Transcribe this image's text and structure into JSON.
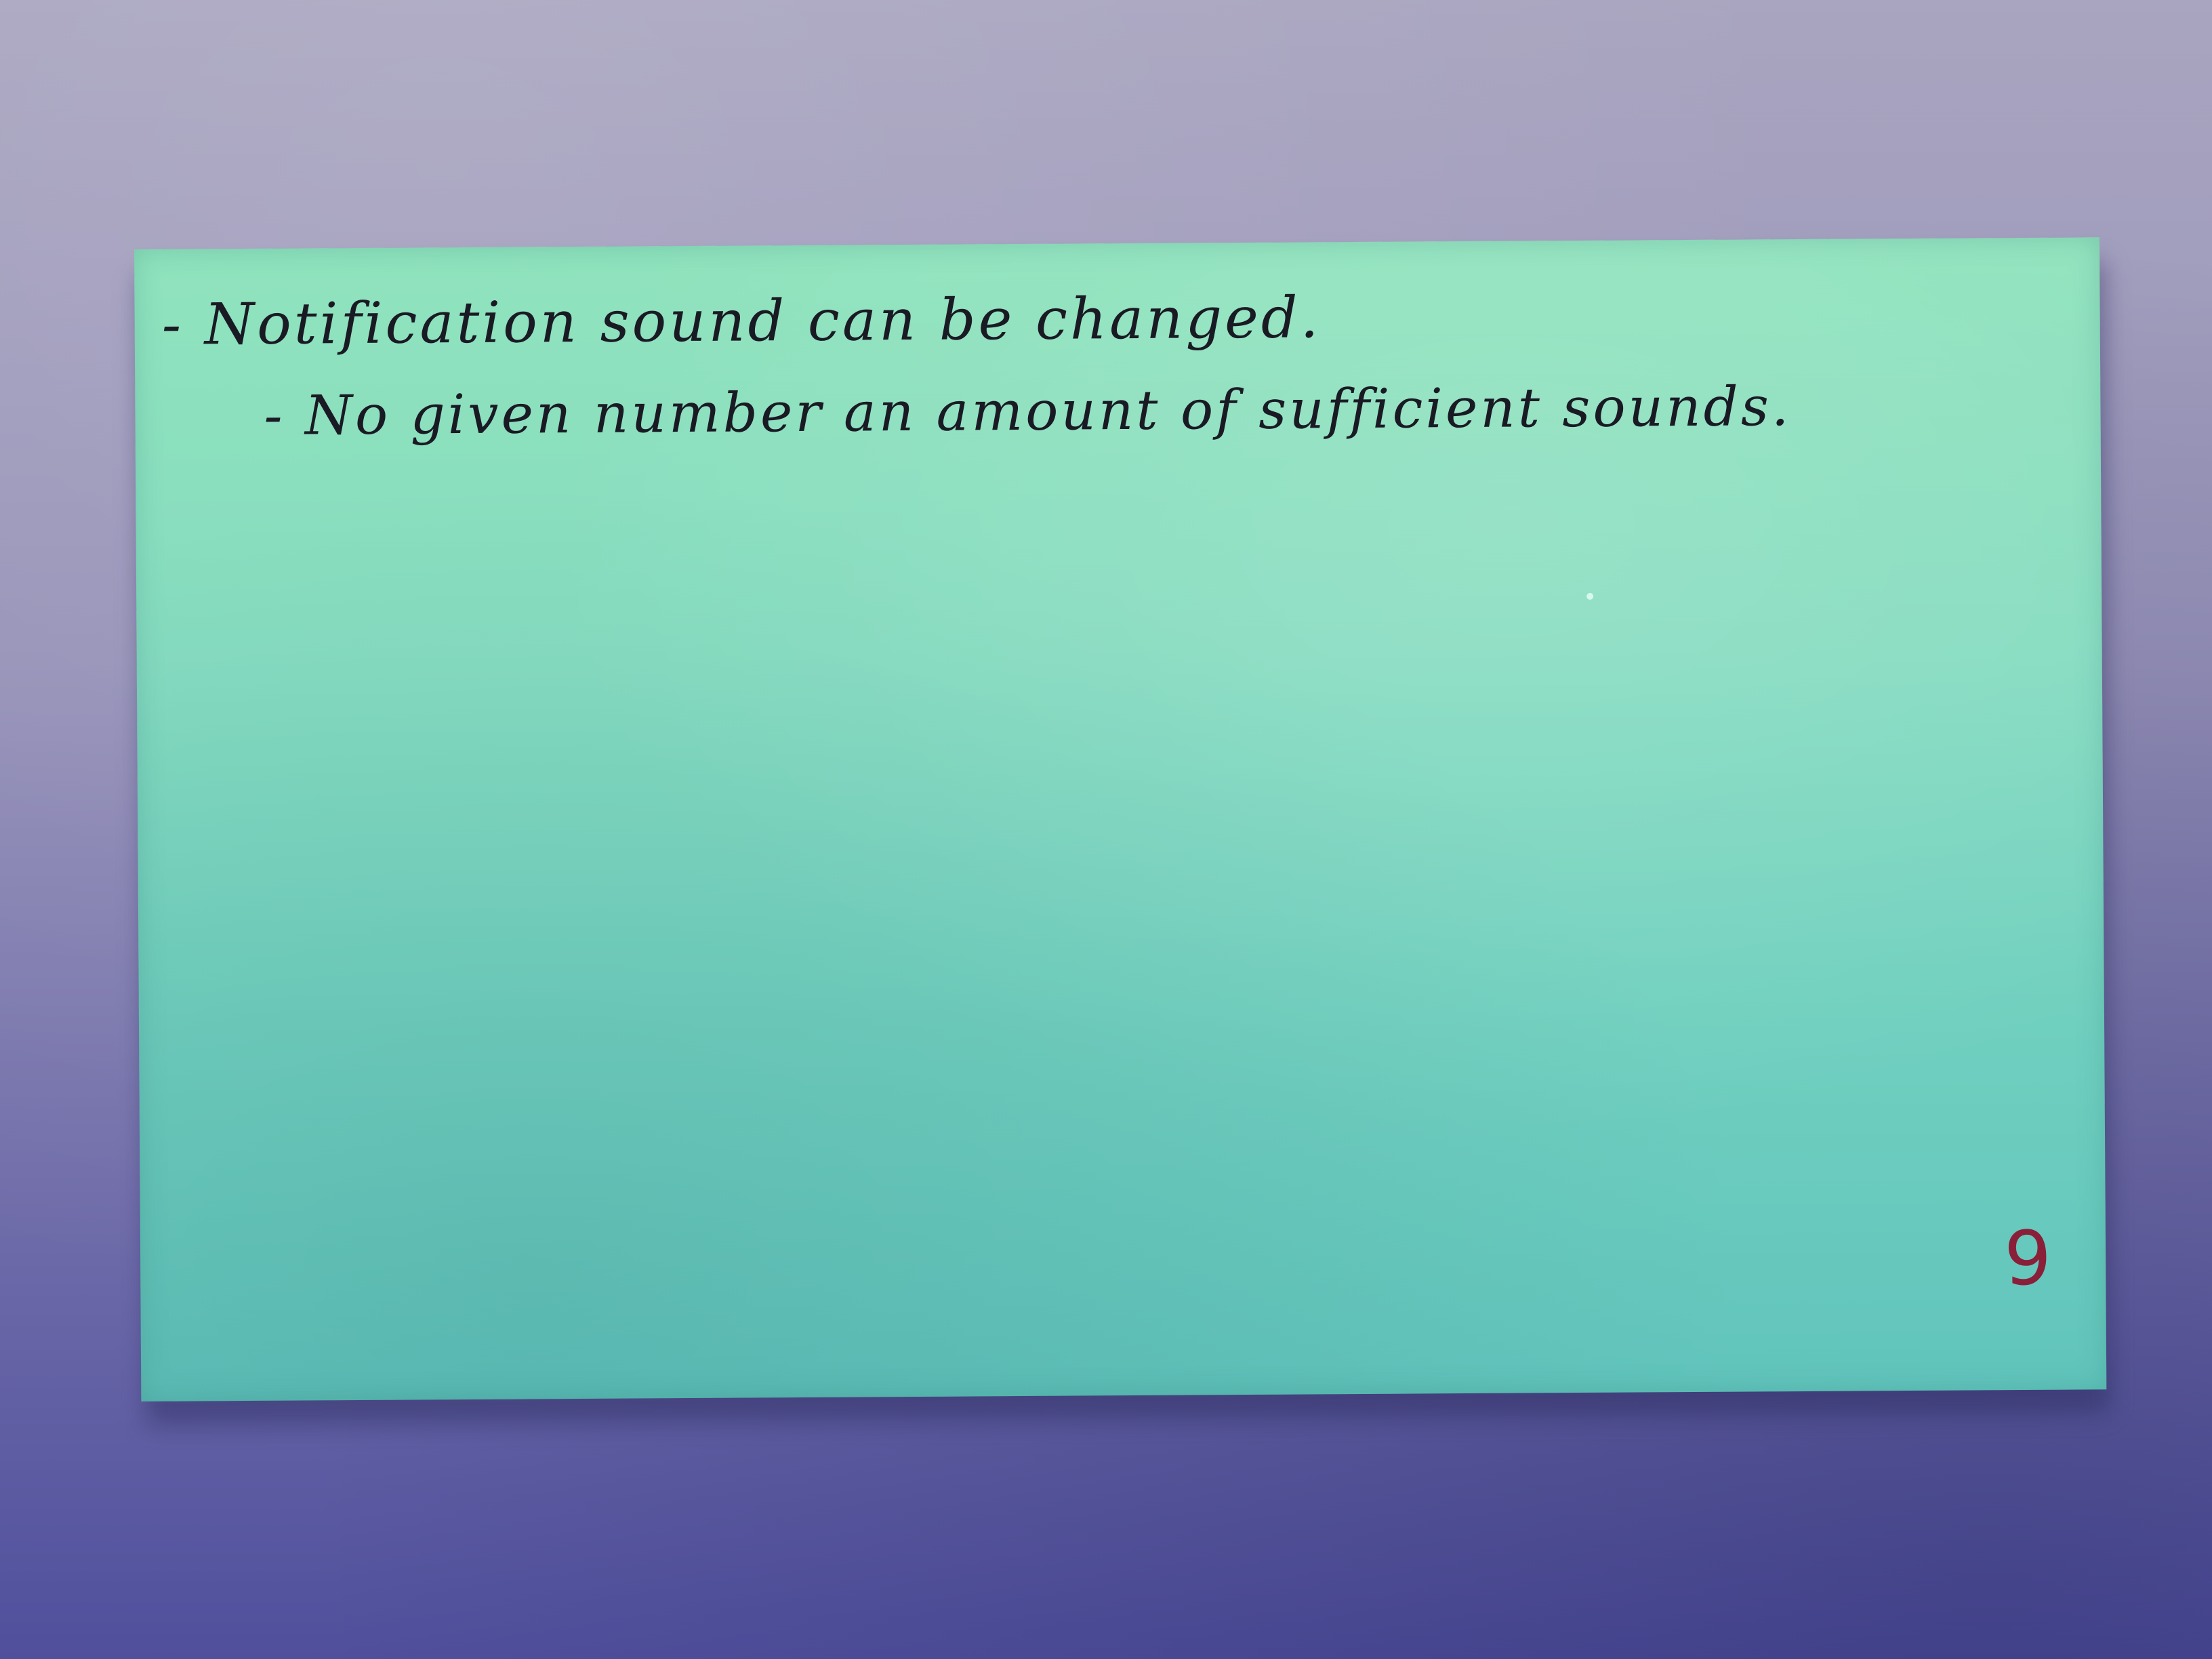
{
  "card": {
    "color": "#86dcc0",
    "notes": [
      "- Notification sound can be changed.",
      "- No given number an amount of sufficient sounds."
    ],
    "page_number": "9",
    "page_number_color": "#8a1f3a"
  },
  "background": {
    "color": "#8c89b6"
  }
}
